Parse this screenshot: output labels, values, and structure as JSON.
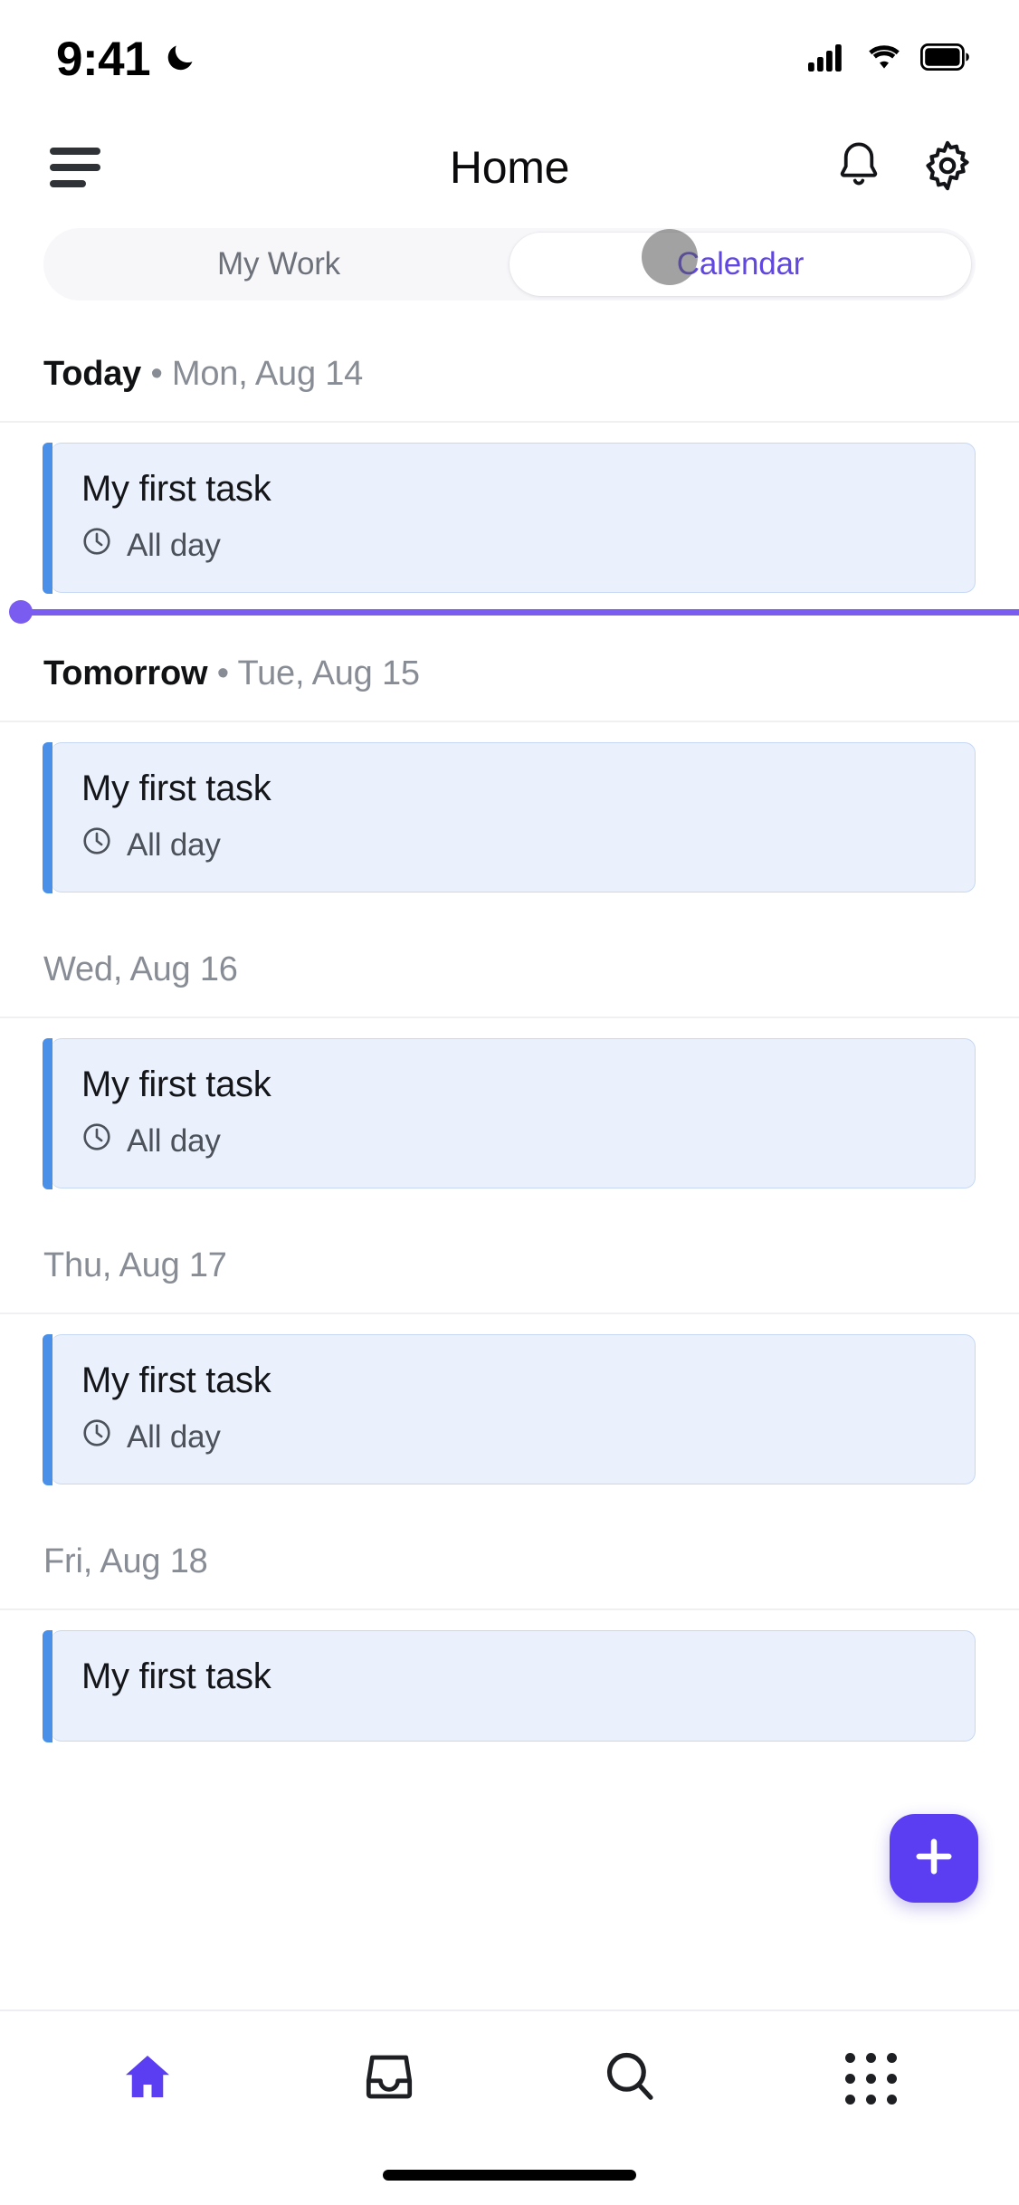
{
  "status_bar": {
    "time": "9:41",
    "dnd_icon": "crescent-moon-icon",
    "signal_icon": "cellular-signal-icon",
    "wifi_icon": "wifi-icon",
    "battery_icon": "battery-full-icon"
  },
  "header": {
    "menu_icon": "hamburger-menu-icon",
    "title": "Home",
    "notifications_icon": "bell-icon",
    "settings_icon": "gear-icon"
  },
  "tabs": {
    "items": [
      {
        "label": "My Work",
        "active": false
      },
      {
        "label": "Calendar",
        "active": true
      }
    ],
    "active_color": "#6147e0",
    "inactive_color": "#6d717a",
    "touch_indicator": "tap-indicator-circle"
  },
  "calendar": {
    "accent_color": "#4a90e8",
    "card_background": "#eaf1fd",
    "now_line_color": "#7a5cf0",
    "clock_icon": "clock-icon",
    "sections": [
      {
        "label": "Today",
        "date": "Mon, Aug 14",
        "separator": "•",
        "emphasis": true,
        "show_now_line": true,
        "tasks": [
          {
            "title": "My first task",
            "time": "All day"
          }
        ]
      },
      {
        "label": "Tomorrow",
        "date": "Tue, Aug 15",
        "separator": "•",
        "emphasis": true,
        "show_now_line": false,
        "tasks": [
          {
            "title": "My first task",
            "time": "All day"
          }
        ]
      },
      {
        "label": "",
        "date": "Wed, Aug 16",
        "separator": "",
        "emphasis": false,
        "show_now_line": false,
        "tasks": [
          {
            "title": "My first task",
            "time": "All day"
          }
        ]
      },
      {
        "label": "",
        "date": "Thu, Aug 17",
        "separator": "",
        "emphasis": false,
        "show_now_line": false,
        "tasks": [
          {
            "title": "My first task",
            "time": "All day"
          }
        ]
      },
      {
        "label": "",
        "date": "Fri, Aug 18",
        "separator": "",
        "emphasis": false,
        "show_now_line": false,
        "tasks": [
          {
            "title": "My first task",
            "time": ""
          }
        ]
      }
    ]
  },
  "fab": {
    "icon": "plus-icon",
    "color": "#5b3df2"
  },
  "bottom_nav": {
    "items": [
      {
        "icon": "home-icon",
        "active": true
      },
      {
        "icon": "inbox-tray-icon",
        "active": false
      },
      {
        "icon": "search-icon",
        "active": false
      },
      {
        "icon": "apps-grid-icon",
        "active": false
      }
    ],
    "active_color": "#5b3df2",
    "inactive_color": "#1d1f23"
  }
}
